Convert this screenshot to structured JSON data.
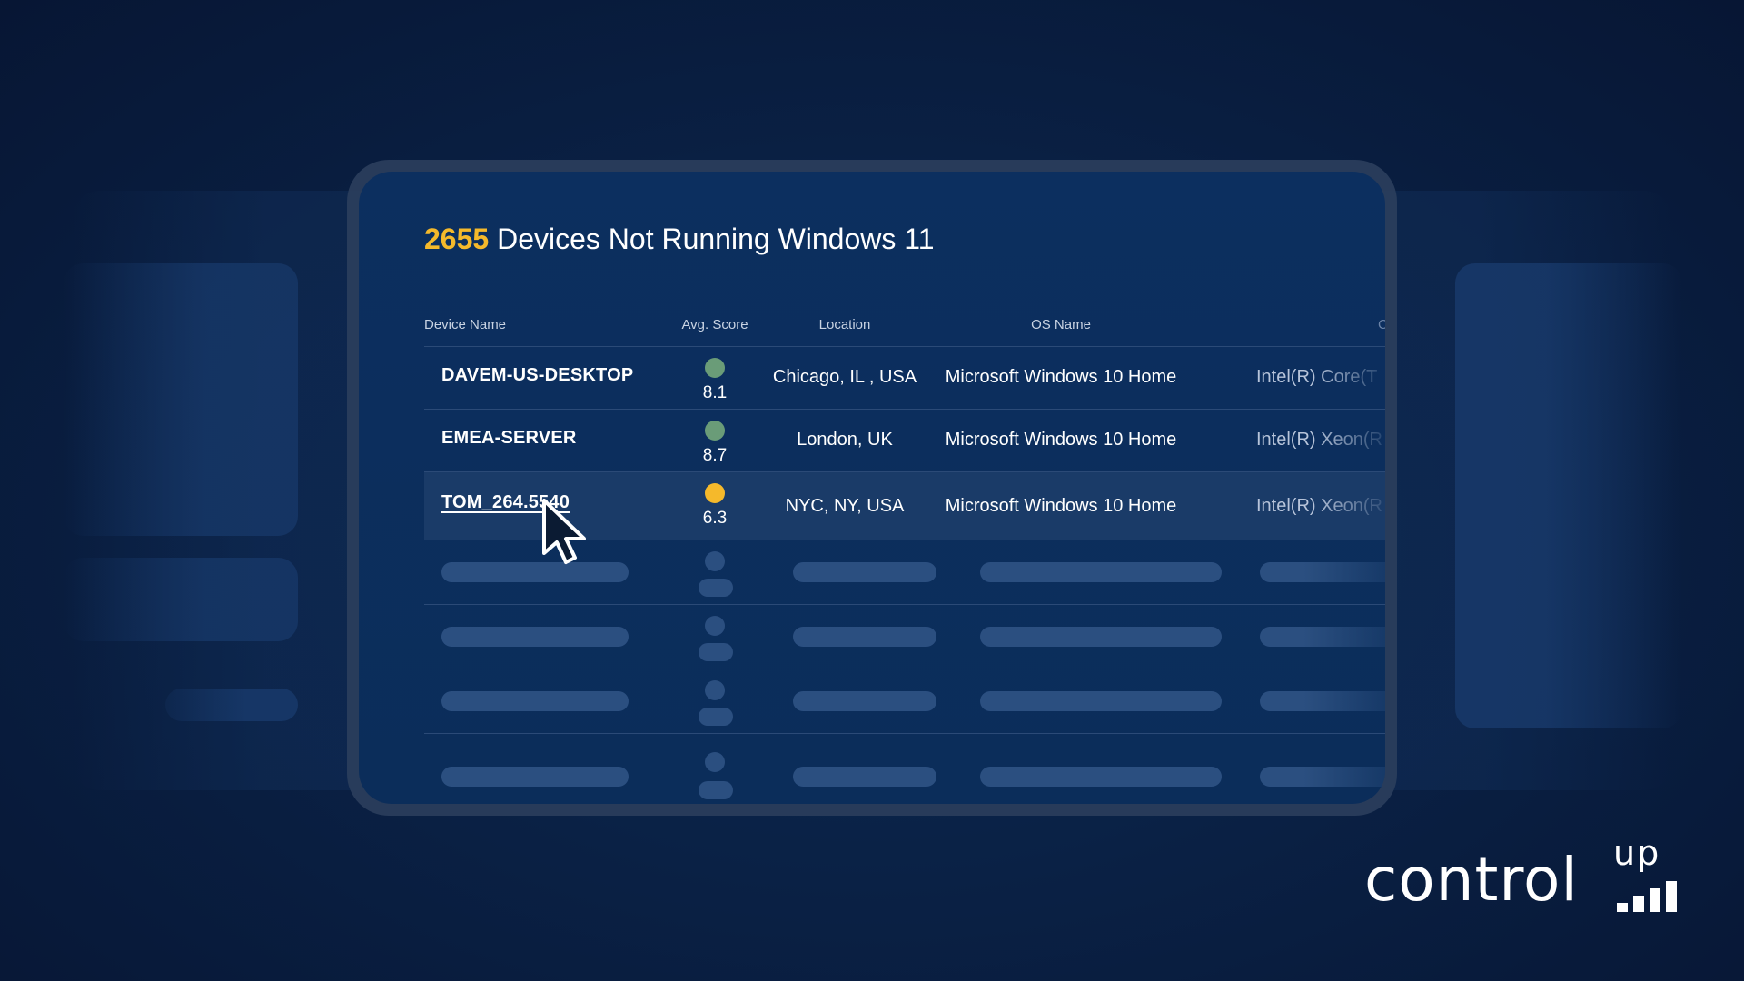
{
  "header": {
    "count": "2655",
    "title_text": "Devices Not Running Windows 11"
  },
  "table": {
    "columns": [
      "Device Name",
      "Avg. Score",
      "Location",
      "OS Name",
      "CPU Name"
    ],
    "rows": [
      {
        "name": "DAVEM-US-DESKTOP",
        "score": "8.1",
        "score_color": "#6a9c78",
        "location": "Chicago, IL , USA",
        "os": "Microsoft Windows 10 Home",
        "cpu": "Intel(R) Core(T"
      },
      {
        "name": "EMEA-SERVER",
        "score": "8.7",
        "score_color": "#6a9c78",
        "location": "London, UK",
        "os": "Microsoft Windows 10 Home",
        "cpu": "Intel(R) Xeon(R"
      },
      {
        "name": "TOM_264.5540",
        "score": "6.3",
        "score_color": "#f5b92b",
        "location": "NYC, NY, USA",
        "os": "Microsoft Windows 10 Home",
        "cpu": "Intel(R) Xeon(R"
      }
    ]
  },
  "logo": {
    "word": "control",
    "superscript": "up"
  },
  "colors": {
    "accent": "#f5b92b",
    "background": "#0a2145",
    "card": "#0c2f5f",
    "score_good": "#6a9c78",
    "score_warn": "#f5b92b"
  },
  "icons": {
    "cursor": "mouse-pointer-icon",
    "logo_bars": "signal-bars-icon"
  }
}
